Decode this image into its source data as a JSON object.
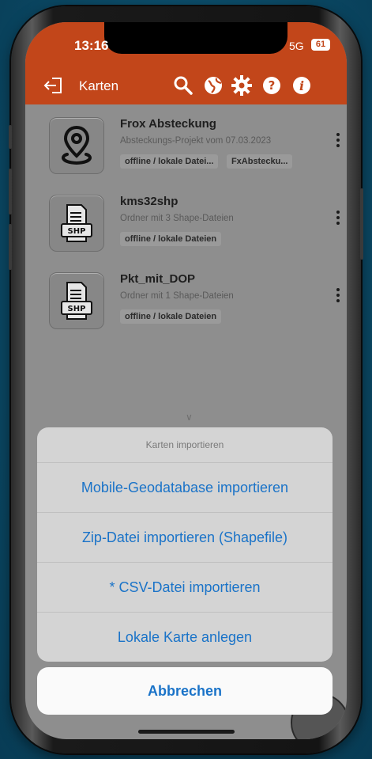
{
  "status": {
    "time": "13:16",
    "network": "5G",
    "battery": "61"
  },
  "header": {
    "title": "Karten",
    "icons": [
      "back-icon",
      "search-icon",
      "globe-icon",
      "gear-icon",
      "help-icon",
      "info-icon"
    ]
  },
  "maps": [
    {
      "title": "Frox Absteckung",
      "description": "Absteckungs-Projekt vom 07.03.2023",
      "tags": [
        "offline / lokale Datei...",
        "FxAbstecku..."
      ],
      "icon": "location-pin-icon"
    },
    {
      "title": "kms32shp",
      "description": "Ordner mit 3 Shape-Dateien",
      "tags": [
        "offline / lokale Dateien"
      ],
      "icon": "shp-file-icon",
      "icon_label": "SHP"
    },
    {
      "title": "Pkt_mit_DOP",
      "description": "Ordner mit 1 Shape-Dateien",
      "tags": [
        "offline / lokale Dateien"
      ],
      "icon": "shp-file-icon",
      "icon_label": "SHP"
    }
  ],
  "action_sheet": {
    "title": "Karten importieren",
    "options": [
      "Mobile-Geodatabase importieren",
      "Zip-Datei importieren (Shapefile)",
      "* CSV-Datei importieren",
      "Lokale Karte anlegen"
    ],
    "cancel": "Abbrechen"
  },
  "colors": {
    "header": "#c2461a",
    "action": "#1a73c8"
  }
}
